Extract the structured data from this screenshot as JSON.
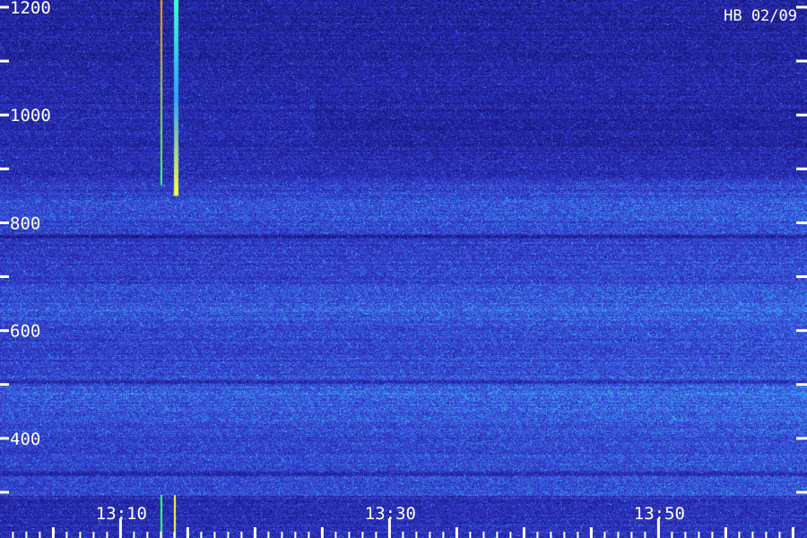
{
  "chart_data": {
    "type": "heatmap",
    "station_label": "HB 02/09",
    "x_axis": {
      "unit": "time",
      "range": [
        "13:01",
        "14:00"
      ],
      "tick_labels": [
        "13:10",
        "13:30",
        "13:50"
      ],
      "major_tick_times": [
        "13:10",
        "13:30",
        "13:50"
      ],
      "minor_tick_interval_min": 5
    },
    "y_axis": {
      "range": [
        300,
        1230
      ],
      "tick_labels": [
        1200,
        1000,
        800,
        600,
        400
      ],
      "tick_values": [
        300,
        400,
        500,
        600,
        700,
        800,
        900,
        1000,
        1100,
        1200
      ]
    },
    "colormap": [
      "#0a0a3c",
      "#1e1e9a",
      "#3a46d8",
      "#3cb4ff",
      "#3cff96",
      "#ffff3c",
      "#ff8c1e"
    ],
    "features": [
      {
        "kind": "vertical_burst",
        "time": "13:13",
        "freq_range": [
          870,
          1230
        ],
        "colors": [
          "#ff9a20",
          "#40ff70"
        ]
      },
      {
        "kind": "vertical_burst",
        "time": "13:14",
        "freq_range": [
          850,
          1230
        ],
        "colors": [
          "#40ffd0",
          "#30a0ff",
          "#ffff40"
        ]
      },
      {
        "kind": "vertical_burst",
        "time": "13:13",
        "freq_range": [
          300,
          308
        ],
        "colors": [
          "#40ff70"
        ]
      },
      {
        "kind": "vertical_burst",
        "time": "13:14",
        "freq_range": [
          300,
          308
        ],
        "colors": [
          "#ffff40"
        ]
      },
      {
        "kind": "horizontal_band",
        "freq": 825,
        "brightness": "elevated"
      },
      {
        "kind": "horizontal_band",
        "freq": 640,
        "brightness": "elevated"
      },
      {
        "kind": "horizontal_band",
        "freq": 470,
        "brightness": "elevated"
      },
      {
        "kind": "dark_line",
        "freq": 775
      },
      {
        "kind": "dark_line",
        "freq": 505
      },
      {
        "kind": "dark_line",
        "freq": 335
      }
    ]
  }
}
